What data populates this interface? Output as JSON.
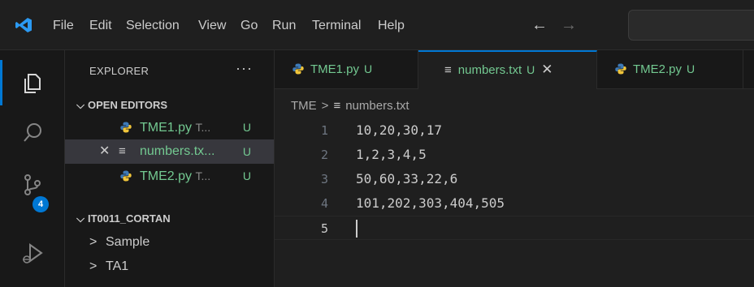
{
  "menu": [
    "File",
    "Edit",
    "Selection",
    "View",
    "Go",
    "Run",
    "Terminal",
    "Help"
  ],
  "nav": {
    "back": "←",
    "forward": "→"
  },
  "activity": {
    "scm_badge": "4"
  },
  "sidebar": {
    "title": "EXPLORER",
    "more": "···",
    "open_editors": {
      "header": "OPEN EDITORS",
      "items": [
        {
          "name": "TME1.py",
          "desc": "T...",
          "status": "U"
        },
        {
          "name": "numbers.tx...",
          "status": "U",
          "close": "✕"
        },
        {
          "name": "TME2.py",
          "desc": "T...",
          "status": "U"
        }
      ]
    },
    "workspace": {
      "header": "IT0011_CORTAN",
      "folders": [
        "Sample",
        "TA1"
      ]
    }
  },
  "tabs": [
    {
      "label": "TME1.py",
      "status": "U"
    },
    {
      "label": "numbers.txt",
      "status": "U",
      "close": "✕"
    },
    {
      "label": "TME2.py",
      "status": "U"
    }
  ],
  "breadcrumb": {
    "folder": "TME",
    "sep": ">",
    "file": "numbers.txt"
  },
  "editor": {
    "lines": [
      {
        "num": "1",
        "text": "10,20,30,17"
      },
      {
        "num": "2",
        "text": "1,2,3,4,5"
      },
      {
        "num": "3",
        "text": "50,60,33,22,6"
      },
      {
        "num": "4",
        "text": "101,202,303,404,505"
      },
      {
        "num": "5",
        "text": ""
      }
    ]
  },
  "colors": {
    "accent": "#0078d4",
    "untracked": "#73c991",
    "python_blue": "#3d7ab8",
    "python_yellow": "#f0c53a"
  }
}
